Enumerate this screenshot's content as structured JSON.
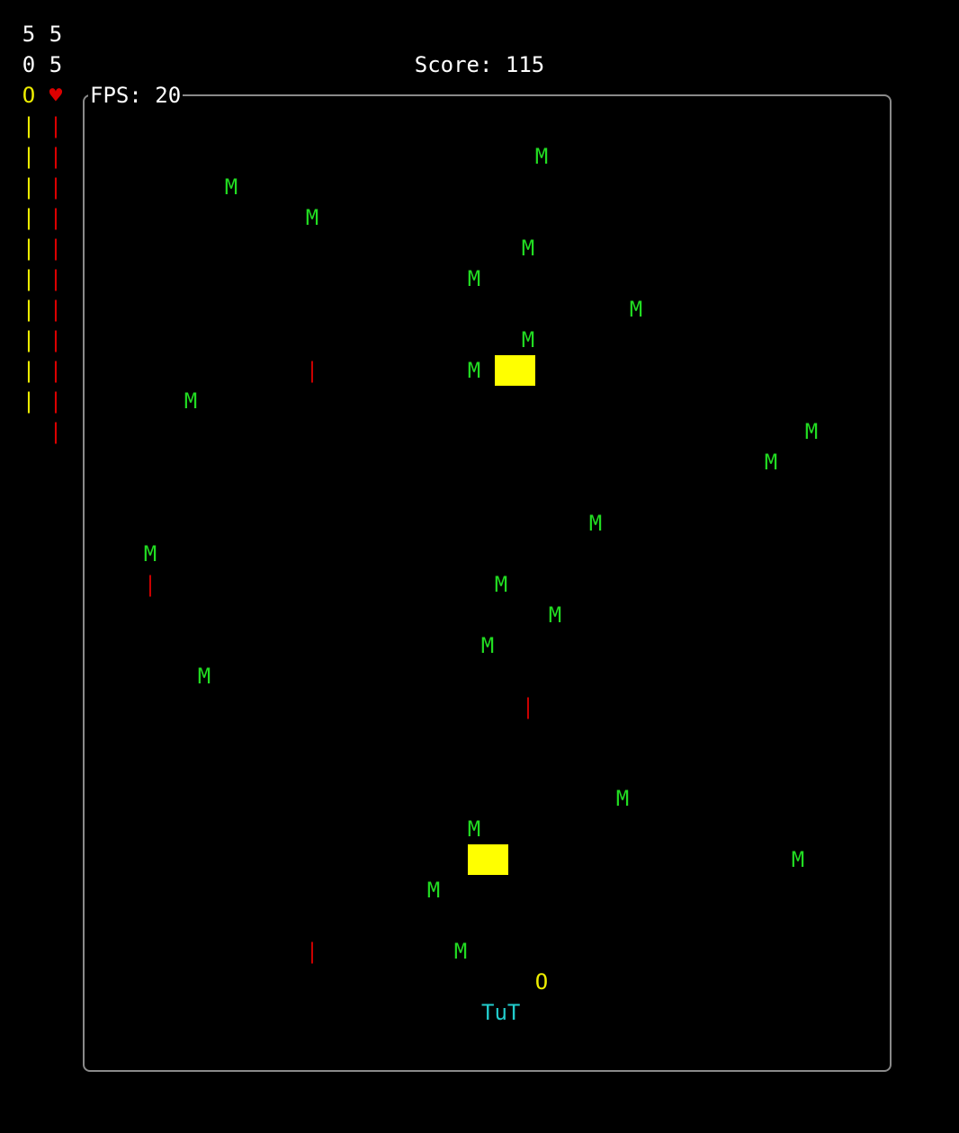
{
  "hud": {
    "counters": [
      [
        "5",
        "5"
      ],
      [
        "0",
        "5"
      ]
    ],
    "ammo_icon": "O",
    "life_icon": "♥",
    "ammo_bar_count": 10,
    "life_bar_count": 11,
    "ammo_tick": "|",
    "life_tick": "|",
    "score": "Score: 115",
    "fps": "FPS: 20"
  },
  "colors": {
    "background": "#000000",
    "monster": "#22dd22",
    "enemy_bullet": "#cc0000",
    "powerup": "#ffff00",
    "player": "#22cccc",
    "player_bullet": "#eeee00",
    "border": "#8a8a8a"
  },
  "game": {
    "monster_glyph": "M",
    "bullet_glyph": "|",
    "player_glyph": "TuT",
    "player_shot_glyph": "O"
  }
}
